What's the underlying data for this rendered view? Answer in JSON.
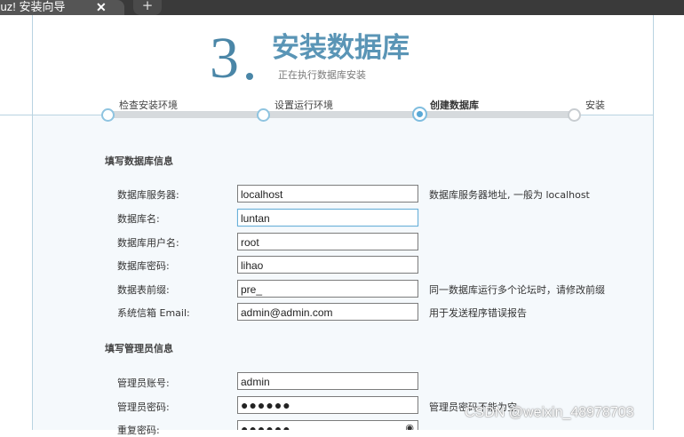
{
  "browser": {
    "tab_title": "cuz! 安装向导",
    "close_glyph": "✕",
    "new_tab_glyph": "+"
  },
  "header": {
    "step_number": "3",
    "title": "安装数据库",
    "subtitle": "正在执行数据库安装"
  },
  "steps": [
    {
      "label": "检查安装环境",
      "state": "done"
    },
    {
      "label": "设置运行环境",
      "state": "done"
    },
    {
      "label": "创建数据库",
      "state": "current"
    },
    {
      "label": "安装",
      "state": "pending"
    }
  ],
  "db_section": {
    "title": "填写数据库信息",
    "rows": [
      {
        "label": "数据库服务器:",
        "value": "localhost",
        "hint": "数据库服务器地址, 一般为 localhost"
      },
      {
        "label": "数据库名:",
        "value": "luntan",
        "hint": ""
      },
      {
        "label": "数据库用户名:",
        "value": "root",
        "hint": ""
      },
      {
        "label": "数据库密码:",
        "value": "lihao",
        "hint": ""
      },
      {
        "label": "数据表前缀:",
        "value": "pre_",
        "hint": "同一数据库运行多个论坛时，请修改前缀"
      },
      {
        "label": "系统信箱 Email:",
        "value": "admin@admin.com",
        "hint": "用于发送程序错误报告"
      }
    ]
  },
  "admin_section": {
    "title": "填写管理员信息",
    "rows": [
      {
        "label": "管理员账号:",
        "value": "admin",
        "hint": ""
      },
      {
        "label": "管理员密码:",
        "value": "●●●●●●",
        "hint": "管理员密码不能为空"
      },
      {
        "label": "重复密码:",
        "value": "●●●●●●",
        "hint": ""
      }
    ]
  },
  "watermark": "CSDN @weixin_48978703",
  "colors": {
    "accent": "#5a95b6",
    "panel_bg": "#f5f9fc",
    "border": "#b9d3e1"
  }
}
